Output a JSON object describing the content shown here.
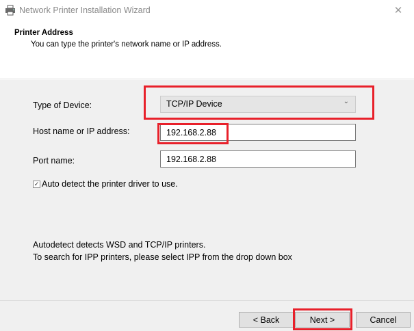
{
  "window": {
    "title": "Network Printer Installation Wizard",
    "close_glyph": "✕",
    "icon": "printer-icon"
  },
  "header": {
    "title": "Printer Address",
    "subtitle": "You can type the printer's network name or IP address."
  },
  "form": {
    "device_type_label": "Type of Device:",
    "device_type_value": "TCP/IP Device",
    "host_label": "Host name or IP address:",
    "host_value": "192.168.2.88",
    "port_label": "Port name:",
    "port_value": "192.168.2.88",
    "auto_detect_label": "Auto detect the printer driver to use.",
    "auto_detect_checked": true
  },
  "notes": {
    "line1": "Autodetect detects WSD and TCP/IP printers.",
    "line2": "To search for IPP printers, please select IPP from the drop down box"
  },
  "buttons": {
    "back": "< Back",
    "next": "Next >",
    "cancel": "Cancel"
  },
  "colors": {
    "highlight": "#e8202a",
    "panel": "#f0f0f0"
  }
}
